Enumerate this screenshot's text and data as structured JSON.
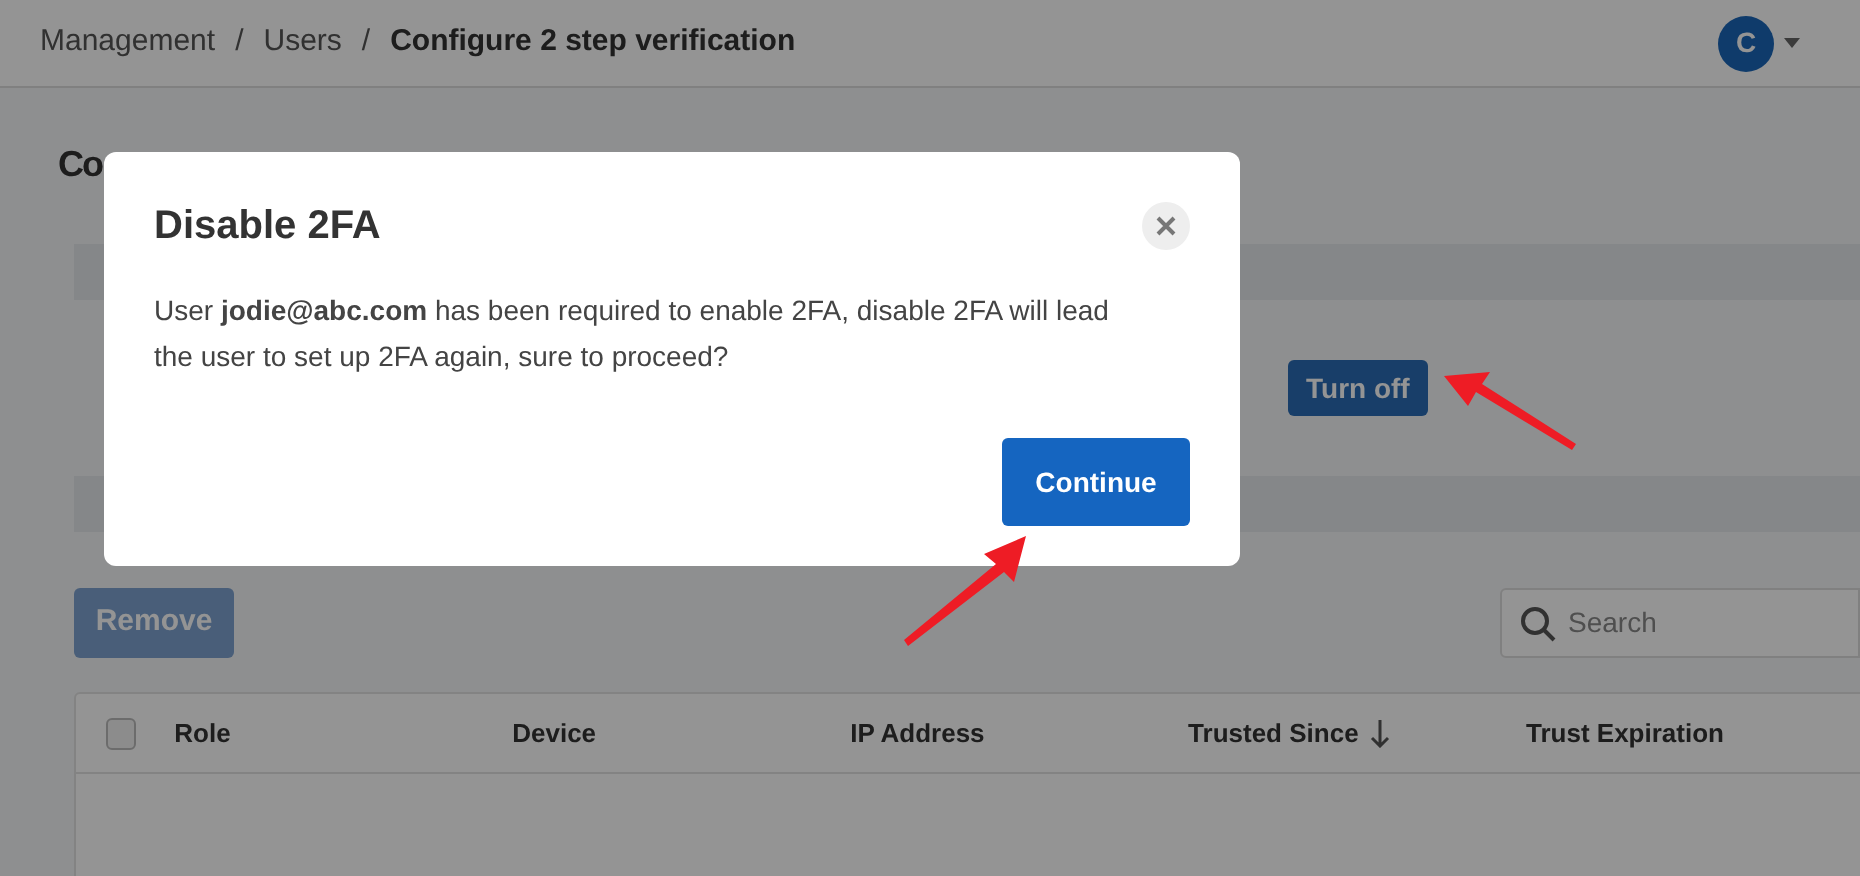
{
  "breadcrumb": [
    {
      "label": "Management",
      "current": false
    },
    {
      "separator": "/",
      "label": "Users",
      "current": false
    },
    {
      "separator": "/",
      "label": "Configure 2 step verification",
      "current": true
    }
  ],
  "user_menu": {
    "avatar": "C"
  },
  "page_heading": "Co",
  "turn_off_button": "Turn off",
  "remove_button": {
    "label": "Remove",
    "disabled": true
  },
  "search": {
    "placeholder": "Search"
  },
  "table": {
    "select_all_checked": false,
    "columns": [
      {
        "label": "Role",
        "sorted": false
      },
      {
        "label": "Device",
        "sorted": false
      },
      {
        "label": "IP Address",
        "sorted": false
      },
      {
        "label": "Trusted Since",
        "sorted": true
      },
      {
        "label": "Trust Expiration",
        "sorted": false
      }
    ]
  },
  "dialog": {
    "title": "Disable 2FA",
    "message": "User **jodie@abc.com** has been required to enable 2FA, disable 2FA will lead the user to set up 2FA again, sure to proceed?",
    "buttons": [
      "Continue"
    ]
  }
}
